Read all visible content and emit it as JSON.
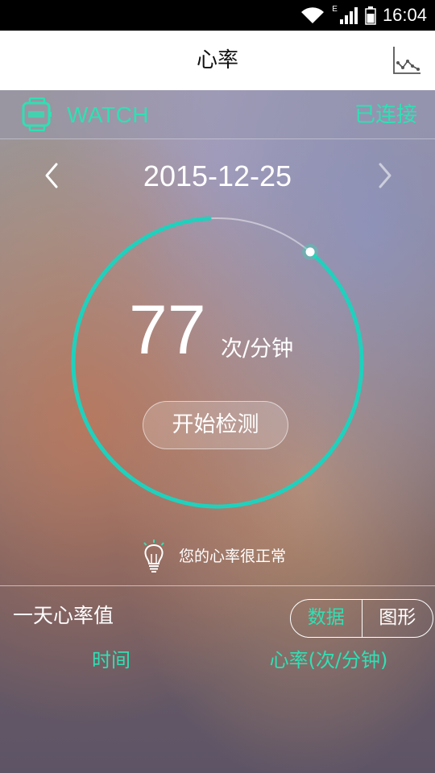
{
  "status_bar": {
    "time": "16:04",
    "icons": [
      "wifi-icon",
      "signal-icon",
      "battery-icon"
    ],
    "network_label": "E"
  },
  "header": {
    "title": "心率",
    "chart_icon": "line-chart-icon"
  },
  "device": {
    "icon": "watch-icon",
    "name": "WATCH",
    "status": "已连接"
  },
  "date_nav": {
    "date": "2015-12-25",
    "prev_icon": "chevron-left-icon",
    "next_icon": "chevron-right-icon"
  },
  "measurement": {
    "value": "77",
    "unit": "次/分钟",
    "progress": 0.88,
    "start_label": "开始检测"
  },
  "tip": {
    "icon": "lightbulb-icon",
    "text": "您的心率很正常"
  },
  "daily": {
    "title": "一天心率值",
    "tabs": [
      {
        "label": "数据",
        "active": true
      },
      {
        "label": "图形",
        "active": false
      }
    ],
    "columns": {
      "time": "时间",
      "rate": "心率(次/分钟)"
    }
  },
  "colors": {
    "accent": "#2fe0b4",
    "ring": "#1fd1bd",
    "header_bg": "#ffffff",
    "status_bg": "#000000"
  }
}
